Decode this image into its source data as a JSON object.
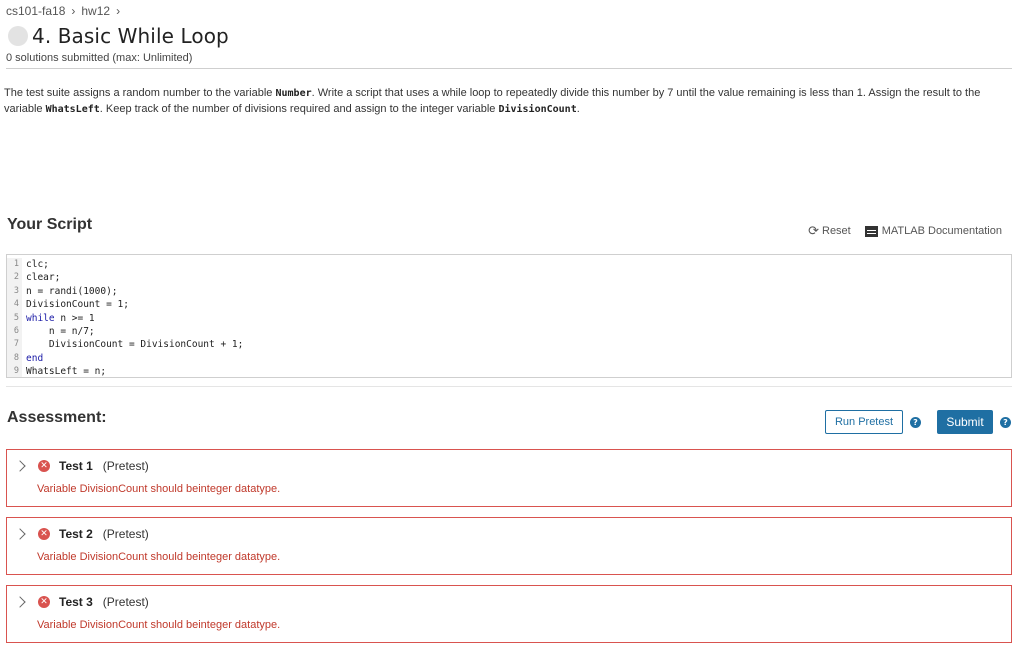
{
  "breadcrumb": [
    "cs101-fa18",
    "hw12"
  ],
  "problem": {
    "title": "4. Basic While Loop",
    "submissions": "0 solutions submitted (max: Unlimited)"
  },
  "description": {
    "p1": "The test suite assigns a random number to the variable ",
    "var1": "Number",
    "p2": ". Write a script that uses a while loop to repeatedly divide this number by 7 until the value remaining is less than 1. Assign the result to the variable ",
    "var2": "WhatsLeft",
    "p3": ". Keep track of the number of divisions required and assign to the integer variable ",
    "var3": "DivisionCount",
    "p4": "."
  },
  "script": {
    "heading": "Your Script",
    "reset": "Reset",
    "docs": "MATLAB Documentation",
    "lines": [
      {
        "n": "1",
        "text": "clc;"
      },
      {
        "n": "2",
        "text": "clear;"
      },
      {
        "n": "3",
        "text": "n = randi(1000);"
      },
      {
        "n": "4",
        "text": "DivisionCount = 1;"
      },
      {
        "n": "5",
        "kw": "while",
        "text": " n >= 1"
      },
      {
        "n": "6",
        "text": "    n = n/7;"
      },
      {
        "n": "7",
        "text": "    DivisionCount = DivisionCount + 1;"
      },
      {
        "n": "8",
        "kw": "end",
        "text": ""
      },
      {
        "n": "9",
        "text": "WhatsLeft = n;"
      }
    ]
  },
  "assessment": {
    "heading": "Assessment:",
    "run_pretest": "Run Pretest",
    "submit": "Submit",
    "help": "?",
    "tests": [
      {
        "name": "Test 1",
        "type": "(Pretest)",
        "message": "Variable DivisionCount should beinteger datatype."
      },
      {
        "name": "Test 2",
        "type": "(Pretest)",
        "message": "Variable DivisionCount should beinteger datatype."
      },
      {
        "name": "Test 3",
        "type": "(Pretest)",
        "message": "Variable DivisionCount should beinteger datatype."
      }
    ]
  },
  "icons": {
    "chevron": "chevron-right-icon",
    "fail": "x-circle-icon",
    "reset": "refresh-icon",
    "docs": "book-icon",
    "help": "question-circle-icon"
  },
  "colors": {
    "accent": "#1f6fa3",
    "error": "#d9534f",
    "error_text": "#c0392b"
  }
}
